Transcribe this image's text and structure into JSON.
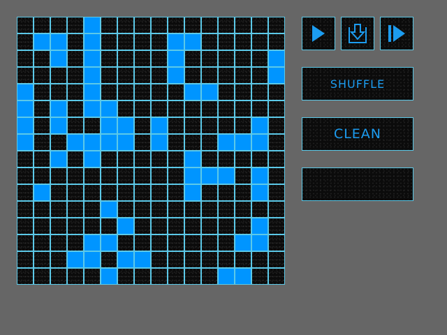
{
  "board": {
    "rows": 16,
    "cols": 16,
    "colors": {
      "on": "#0095ff",
      "off": "#0b0b0b",
      "gridline": "#5cc9e8",
      "background": "#666666"
    },
    "cells": [
      "0000100000000000",
      "0110100001100000",
      "0010100001000001",
      "0000100001000001",
      "1000100000110000",
      "1010110000000000",
      "1010011010000010",
      "1001111010001110",
      "0010100000100000",
      "0000000000111010",
      "0100000000100010",
      "0000010000000000",
      "0000001000000010",
      "0000110000000110",
      "0001101100000000",
      "0000010000001100"
    ]
  },
  "toolbar": {
    "play_icon": "play-icon",
    "save_icon": "download-icon",
    "step_icon": "step-forward-icon"
  },
  "buttons": {
    "shuffle_label": "SHUFFLE",
    "clean_label": "CLEAN",
    "blank_label": ""
  }
}
